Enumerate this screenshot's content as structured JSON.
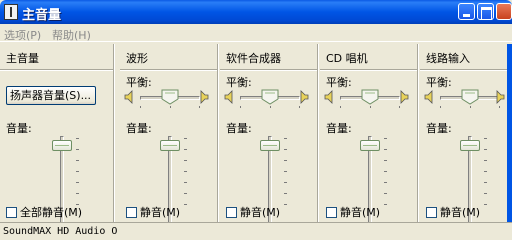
{
  "window": {
    "title": "主音量"
  },
  "menu": {
    "options": "选项(P)",
    "help": "帮助(H)"
  },
  "master": {
    "title": "主音量",
    "speaker_button": "扬声器音量(S)...",
    "volume_label": "音量:",
    "volume_level": 0.96,
    "mute_label": "全部静音(M)",
    "muted": false
  },
  "channels": [
    {
      "title": "波形",
      "balance_label": "平衡:",
      "volume_label": "音量:",
      "mute_label": "静音(M)",
      "balance": 0.5,
      "volume_level": 0.96,
      "muted": false
    },
    {
      "title": "软件合成器",
      "balance_label": "平衡:",
      "volume_label": "音量:",
      "mute_label": "静音(M)",
      "balance": 0.5,
      "volume_level": 0.96,
      "muted": false
    },
    {
      "title": "CD 唱机",
      "balance_label": "平衡:",
      "volume_label": "音量:",
      "mute_label": "静音(M)",
      "balance": 0.5,
      "volume_level": 0.96,
      "muted": false
    },
    {
      "title": "线路输入",
      "balance_label": "平衡:",
      "volume_label": "音量:",
      "mute_label": "静音(M)",
      "balance": 0.5,
      "volume_level": 0.96,
      "muted": false
    }
  ],
  "status": {
    "text": "SoundMAX HD Audio O"
  },
  "colors": {
    "titlebar": "#0055e5",
    "window_bg": "#ece9d8",
    "thumb_border": "#6e8f63"
  }
}
